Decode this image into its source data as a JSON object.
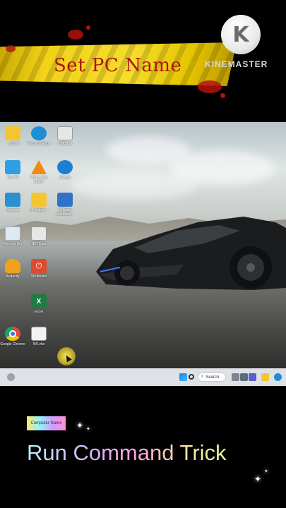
{
  "banner": {
    "title": "Set PC Name"
  },
  "watermark": {
    "logo_letter": "K",
    "text": "KINEMASTER"
  },
  "desktop": {
    "icons": [
      {
        "label": "...admin",
        "name": "desktop-icon-folder-admin",
        "color": "#f4c531"
      },
      {
        "label": "Microsoft Edge",
        "name": "desktop-icon-edge",
        "color": "#1c8fd6"
      },
      {
        "label": "CMD.bat",
        "name": "desktop-icon-cmd-bat",
        "color": "#e6e6e6"
      },
      {
        "label": "This PC",
        "name": "desktop-icon-this-pc",
        "color": "#2da0e3"
      },
      {
        "label": "VLC media player",
        "name": "desktop-icon-vlc",
        "color": "#f08a12"
      },
      {
        "label": "Google",
        "name": "desktop-icon-google",
        "color": "#1d7fd4"
      },
      {
        "label": "Network",
        "name": "desktop-icon-network",
        "color": "#2b8fd0"
      },
      {
        "label": "24 Snippe...",
        "name": "desktop-icon-folder-snippets",
        "color": "#f4c531"
      },
      {
        "label": "VMware Workstati...",
        "name": "desktop-icon-vmware",
        "color": "#2e73c9"
      },
      {
        "label": "Recycle Bin",
        "name": "desktop-icon-recycle-bin",
        "color": "#dfe9f3"
      },
      {
        "label": "NETF.bat",
        "name": "desktop-icon-netf-bat",
        "color": "#e6e6e6"
      },
      {
        "label": "Audacity",
        "name": "desktop-icon-audacity",
        "color": "#f0a21e"
      },
      {
        "label": "Shutdown",
        "name": "desktop-icon-shutdown",
        "color": "#e0482f"
      },
      {
        "label": "Excel",
        "name": "desktop-icon-excel",
        "color": "#1f7a45"
      },
      {
        "label": "Google Chrome",
        "name": "desktop-icon-chrome",
        "color": "#e2463c"
      },
      {
        "label": "NR.vbs",
        "name": "desktop-icon-nr-vbs",
        "color": "#f2f2f2"
      }
    ]
  },
  "taskbar": {
    "search_label": "Search"
  },
  "bottom": {
    "chip_text": "Computer Name",
    "caption": "Run Command Trick"
  }
}
